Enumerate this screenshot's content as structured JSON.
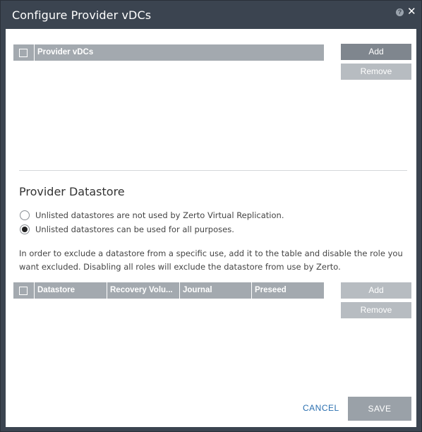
{
  "dialog": {
    "title": "Configure Provider vDCs"
  },
  "provider_vdcs": {
    "column": "Provider vDCs",
    "add_label": "Add",
    "remove_label": "Remove"
  },
  "datastore": {
    "section_title": "Provider Datastore",
    "radio_options": [
      {
        "label": "Unlisted datastores are not used by Zerto Virtual Replication.",
        "selected": false
      },
      {
        "label": "Unlisted datastores can be used for all purposes.",
        "selected": true
      }
    ],
    "info": "In order to exclude a datastore from a specific use, add it to the table and disable the role you want excluded. Disabling all roles will exclude the datastore from use by Zerto.",
    "columns": [
      "Datastore",
      "Recovery Volu...",
      "Journal",
      "Preseed"
    ],
    "add_label": "Add",
    "remove_label": "Remove"
  },
  "footer": {
    "cancel_label": "CANCEL",
    "save_label": "SAVE"
  }
}
